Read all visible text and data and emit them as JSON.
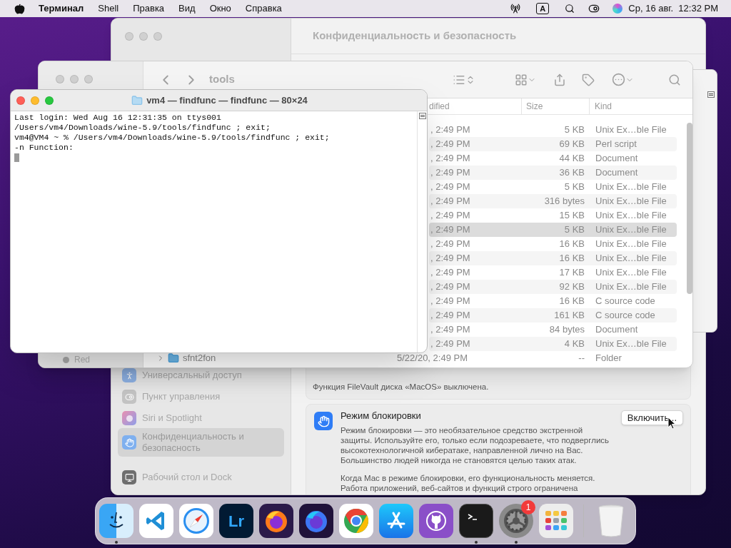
{
  "menu_bar": {
    "app_name": "Терминал",
    "menus": [
      "Shell",
      "Правка",
      "Вид",
      "Окно",
      "Справка"
    ],
    "input_source": "A",
    "clock": "Ср, 16 авг.  12:32 PM"
  },
  "settings_window": {
    "title": "Конфиденциальность и безопасность",
    "sidebar": {
      "groups": [
        [
          {
            "label": "Универсальный доступ",
            "kind": "accessibility",
            "selected": false
          },
          {
            "label": "Пункт управления",
            "kind": "control-center",
            "selected": false
          },
          {
            "label": "Siri и Spotlight",
            "kind": "siri",
            "selected": false
          },
          {
            "label": "Конфиденциальность и безопасность",
            "kind": "privacy",
            "selected": true
          }
        ],
        [
          {
            "label": "Рабочий стол и Dock",
            "kind": "desktop-dock",
            "selected": false
          }
        ]
      ]
    },
    "filevault_status": "Функция FileVault диска «MacOS» выключена.",
    "lockdown": {
      "title": "Режим блокировки",
      "description": "Режим блокировки — это необязательное средство экстренной защиты. Используйте его, только если подозреваете, что подверглись высокотехнологичной кибератаке, направленной лично на Вас. Большинство людей никогда не становятся целью таких атак.",
      "note": "Когда Mac в режиме блокировки, его функциональность меняется. Работа приложений, веб-сайтов и функций строго ограничена",
      "button": "Включить..."
    }
  },
  "finder_window": {
    "title": "tools",
    "sidebar_tag": "Red",
    "columns": [
      "dified",
      "Size",
      "Kind"
    ],
    "rows": [
      {
        "date": ", 2:49 PM",
        "size": "5 KB",
        "kind": "Unix Ex…ble File",
        "selected": false
      },
      {
        "date": ", 2:49 PM",
        "size": "69 KB",
        "kind": "Perl script",
        "selected": false
      },
      {
        "date": ", 2:49 PM",
        "size": "44 KB",
        "kind": "Document",
        "selected": false
      },
      {
        "date": ", 2:49 PM",
        "size": "36 KB",
        "kind": "Document",
        "selected": false
      },
      {
        "date": ", 2:49 PM",
        "size": "5 KB",
        "kind": "Unix Ex…ble File",
        "selected": false
      },
      {
        "date": ", 2:49 PM",
        "size": "316 bytes",
        "kind": "Unix Ex…ble File",
        "selected": false
      },
      {
        "date": ", 2:49 PM",
        "size": "15 KB",
        "kind": "Unix Ex…ble File",
        "selected": false
      },
      {
        "date": ", 2:49 PM",
        "size": "5 KB",
        "kind": "Unix Ex…ble File",
        "selected": true
      },
      {
        "date": ", 2:49 PM",
        "size": "16 KB",
        "kind": "Unix Ex…ble File",
        "selected": false
      },
      {
        "date": ", 2:49 PM",
        "size": "16 KB",
        "kind": "Unix Ex…ble File",
        "selected": false
      },
      {
        "date": ", 2:49 PM",
        "size": "17 KB",
        "kind": "Unix Ex…ble File",
        "selected": false
      },
      {
        "date": ", 2:49 PM",
        "size": "92 KB",
        "kind": "Unix Ex…ble File",
        "selected": false
      },
      {
        "date": ", 2:49 PM",
        "size": "16 KB",
        "kind": "C source code",
        "selected": false
      },
      {
        "date": ", 2:49 PM",
        "size": "161 KB",
        "kind": "C source code",
        "selected": false
      },
      {
        "date": ", 2:49 PM",
        "size": "84 bytes",
        "kind": "Document",
        "selected": false
      },
      {
        "date": ", 2:49 PM",
        "size": "4 KB",
        "kind": "Unix Ex…ble File",
        "selected": false
      },
      {
        "name": "sfnt2fon",
        "date": "5/22/20, 2:49 PM",
        "size": "--",
        "kind": "Folder",
        "selected": false
      }
    ]
  },
  "terminal_window": {
    "title": "vm4 — findfunc — findfunc — 80×24",
    "lines": [
      "Last login: Wed Aug 16 12:31:35 on ttys001",
      "/Users/vm4/Downloads/wine-5.9/tools/findfunc ; exit;",
      "vm4@VM4 ~ % /Users/vm4/Downloads/wine-5.9/tools/findfunc ; exit;",
      "-n Function:"
    ]
  },
  "dock": {
    "items": [
      {
        "kind": "finder",
        "running": true
      },
      {
        "kind": "vscode",
        "running": false
      },
      {
        "kind": "safari",
        "running": false
      },
      {
        "kind": "lightroom",
        "label": "Lr",
        "running": false
      },
      {
        "kind": "firefox",
        "running": false
      },
      {
        "kind": "firefox-dev",
        "running": false
      },
      {
        "kind": "chrome",
        "running": false
      },
      {
        "kind": "app-store",
        "running": false
      },
      {
        "kind": "github",
        "running": false
      },
      {
        "kind": "terminal",
        "running": true
      },
      {
        "kind": "settings",
        "badge": "1",
        "running": true
      },
      {
        "kind": "launchpad",
        "running": false
      }
    ],
    "trash": {
      "kind": "trash"
    }
  }
}
